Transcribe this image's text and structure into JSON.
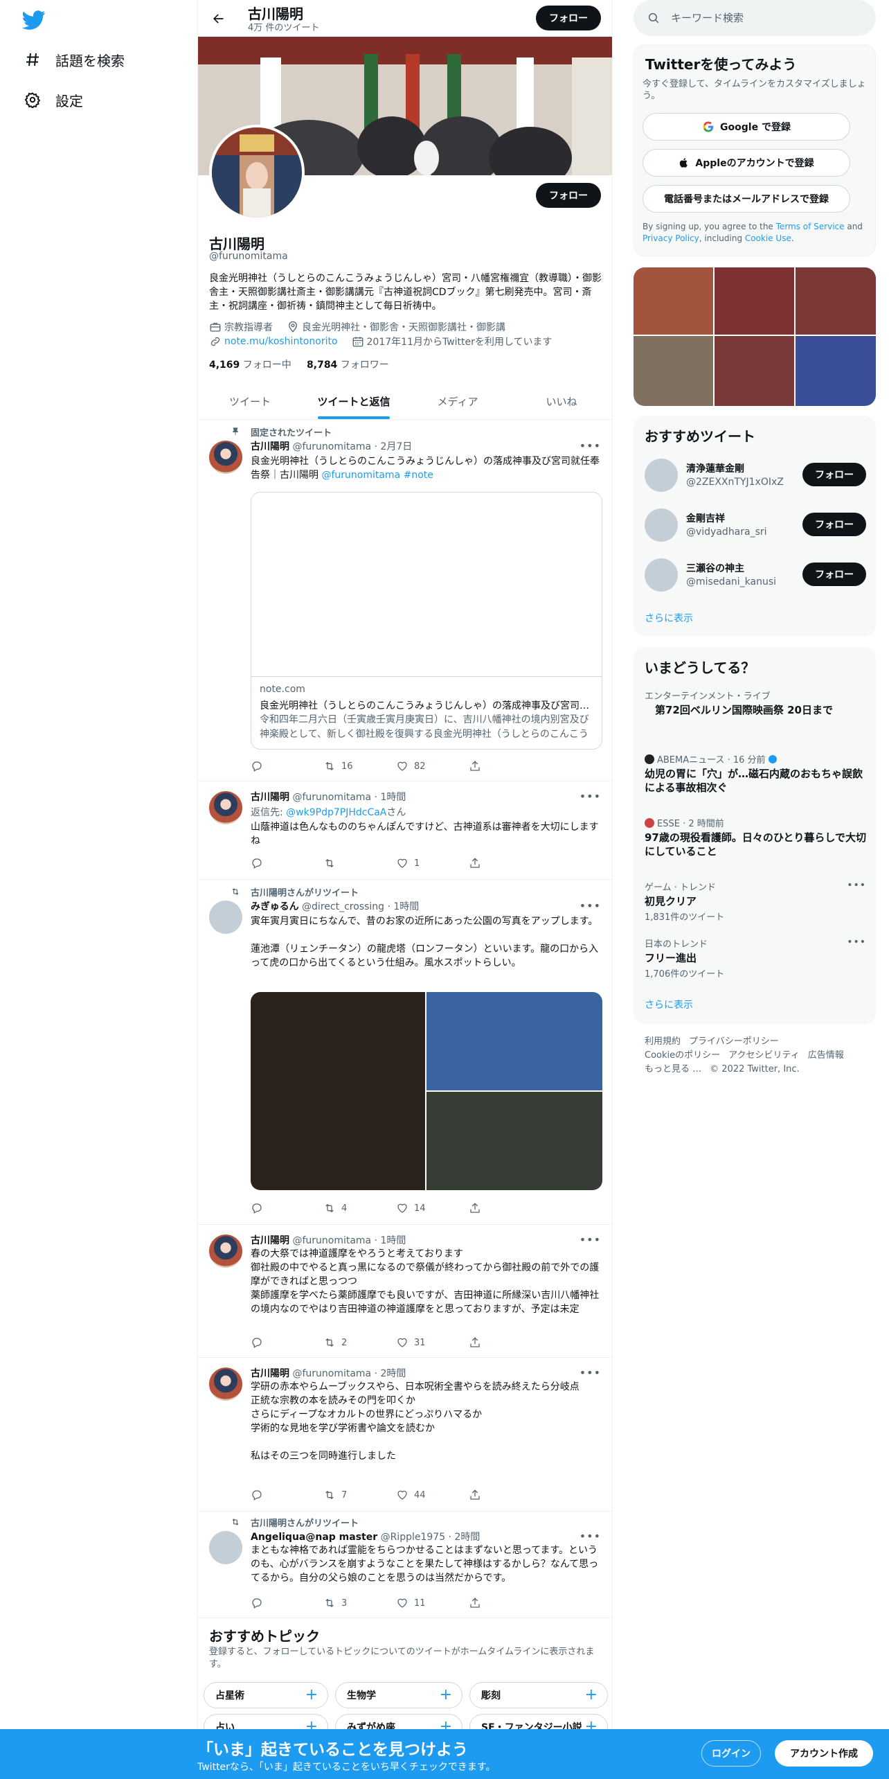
{
  "nav": {
    "explore": "話題を検索",
    "settings": "設定"
  },
  "header": {
    "name": "古川陽明",
    "tweet_count": "4万 件のツイート",
    "follow": "フォロー"
  },
  "profile": {
    "name": "古川陽明",
    "handle": "@furunomitama",
    "follow": "フォロー",
    "bio": "良金光明神社（うしとらのこんこうみょうじんしゃ）宮司・八幡宮権禰宜（教導職）・御影舎主・天照御影講社斎主・御影講講元『古神道祝詞CDブック』第七刷発売中。宮司・斎主・祝詞講座・御祈祷・鎮問神主として毎日祈祷中。",
    "category": "宗教指導者",
    "location": "良金光明神社・御影舎・天照御影講社・御影講",
    "link": "note.mu/koshintonorito",
    "joined": "2017年11月からTwitterを利用しています",
    "following_count": "4,169",
    "following_label": "フォロー中",
    "followers_count": "8,784",
    "followers_label": "フォロワー"
  },
  "tabs": [
    "ツイート",
    "ツイートと返信",
    "メディア",
    "いいね"
  ],
  "tweets": [
    {
      "context": "固定されたツイート",
      "name": "古川陽明",
      "meta": "@furunomitama · 2月7日",
      "text_a": "良金光明神社（うしとらのこんこうみょうじんしゃ）の落成神事及び宮司就任奉告祭｜古川陽明 ",
      "text_mention": "@furunomitama",
      "text_tag": " #note",
      "card": {
        "domain": "note.com",
        "title": "良金光明神社（うしとらのこんこうみょうじんしゃ）の落成神事及び宮司就任奉告祭｜古川陽明",
        "desc": "令和四年二月六日（壬寅歳壬寅月庚寅日）に、吉川八幡神社の境内別宮及び神楽殿として、新しく御社殿を復興する良金光明神社（うしとらのこんこうみょうじんしゃ）の落成神事及び宮司就任奉告祭を斎行しました。"
      },
      "retweets": "16",
      "likes": "82"
    },
    {
      "name": "古川陽明",
      "meta": "@furunomitama · 1時間",
      "reply_prefix": "返信先: ",
      "reply_to": "@wk9Pdp7PJHdcCaA",
      "reply_suffix": "さん",
      "text": "山蔭神道は色んなもののちゃんぽんですけど、古神道系は審神者を大切にしますね",
      "retweets": "",
      "likes": "1"
    },
    {
      "context": "古川陽明さんがリツイート",
      "name": "みぎゅるん",
      "meta": "@direct_crossing · 1時間",
      "text": "寅年寅月寅日にちなんで、昔のお家の近所にあった公園の写真をアップします。\n\n蓮池潭（リェンチータン）の龍虎塔（ロンフータン）といいます。龍の口から入って虎の口から出てくるという仕組み。風水スポットらしい。",
      "retweets": "4",
      "likes": "14"
    },
    {
      "name": "古川陽明",
      "meta": "@furunomitama · 1時間",
      "text": "春の大祭では神道護摩をやろうと考えております\n御社殿の中でやると真っ黒になるので祭儀が終わってから御社殿の前で外での護摩ができればと思っつつ\n薬師護摩を学べたら薬師護摩でも良いですが、吉田神道に所縁深い吉川八幡神社の境内なのでやはり吉田神道の神道護摩をと思っておりますが、予定は未定",
      "retweets": "2",
      "likes": "31"
    },
    {
      "name": "古川陽明",
      "meta": "@furunomitama · 2時間",
      "text": "学研の赤本やらムーブックスやら、日本呪術全書やらを読み終えたら分岐点\n正統な宗教の本を読みその門を叩くか\nさらにディープなオカルトの世界にどっぷりハマるか\n学術的な見地を学び学術書や論文を読むか\n\n私はその三つを同時進行しました",
      "retweets": "7",
      "likes": "44"
    },
    {
      "context": "古川陽明さんがリツイート",
      "name": "Angeliqua@nap master",
      "meta": "@Ripple1975 · 2時間",
      "text": "まともな神格であれば霊能をちらつかせることはまずないと思ってます。というのも、心がバランスを崩すようなことを果たして神様はするかしら？なんて思ってるから。自分の父ら娘のことを思うのは当然だからです。",
      "retweets": "3",
      "likes": "11"
    }
  ],
  "topics": {
    "title": "おすすめトピック",
    "subtitle": "登録すると、フォローしているトピックについてのツイートがホームタイムラインに表示されます。",
    "chips": [
      "占星術",
      "生物学",
      "彫刻",
      "占い",
      "みずがめ座",
      "SF・ファンタジー小説"
    ]
  },
  "search": {
    "placeholder": "キーワード検索"
  },
  "signup": {
    "title": "Twitterを使ってみよう",
    "subtitle": "今すぐ登録して、タイムラインをカスタマイズしましょう。",
    "google": "Google で登録",
    "apple": "Appleのアカウントで登録",
    "phone": "電話番号またはメールアドレスで登録",
    "terms_a": "By signing up, you agree to the ",
    "terms_tos": "Terms of Service",
    "terms_b": " and ",
    "terms_privacy": "Privacy Policy",
    "terms_c": ", including ",
    "terms_cookie": "Cookie Use",
    "terms_d": "."
  },
  "recommend": {
    "title": "おすすめツイート",
    "items": [
      {
        "name": "清浄蓮華金剛",
        "handle": "@2ZEXXnTYJ1xOIxZ",
        "follow": "フォロー"
      },
      {
        "name": "金剛吉祥",
        "handle": "@vidyadhara_sri",
        "follow": "フォロー"
      },
      {
        "name": "三瀬谷の神主",
        "handle": "@misedani_kanusi",
        "follow": "フォロー"
      }
    ],
    "more": "さらに表示"
  },
  "trends": {
    "title": "いまどうしてる？",
    "items": [
      {
        "context": "エンターテインメント・ライブ",
        "title": "　第72回ベルリン国際映画祭 20日まで",
        "count": ""
      },
      {
        "context": "ABEMAニュース · 16 分前",
        "title": "幼児の胃に「穴」が…磁石内蔵のおもちゃ誤飲による事故相次ぐ",
        "count": ""
      },
      {
        "context": "ESSE · 2 時間前",
        "title": "97歳の現役看護師。日々のひとり暮らしで大切にしていること",
        "count": ""
      },
      {
        "context": "ゲーム · トレンド",
        "title": "初見クリア",
        "count": "1,831件のツイート"
      },
      {
        "context": "日本のトレンド",
        "title": "フリー進出",
        "count": "1,706件のツイート"
      }
    ],
    "more": "さらに表示"
  },
  "footer": {
    "terms": "利用規約",
    "privacy": "プライバシーポリシー",
    "cookie": "Cookieのポリシー",
    "accessibility": "アクセシビリティ",
    "ads": "広告情報",
    "more": "もっと見る …",
    "copyright": "© 2022 Twitter, Inc."
  },
  "bottom": {
    "title": "「いま」起きていることを見つけよう",
    "subtitle": "Twitterなら、「いま」起きていることをいち早くチェックできます。",
    "login": "ログイン",
    "signup": "アカウント作成"
  },
  "colors": {
    "accent": "#1d9bf0",
    "text": "#0f1419",
    "secondary": "#536471",
    "border": "#eff3f4"
  },
  "icons": [
    "twitter-logo-icon",
    "hashtag-icon",
    "gear-icon",
    "back-arrow-icon",
    "search-icon",
    "briefcase-icon",
    "location-icon",
    "link-icon",
    "calendar-icon",
    "pin-icon",
    "retweet-icon",
    "reply-icon",
    "like-icon",
    "share-icon",
    "more-icon",
    "google-icon",
    "apple-icon",
    "verified-icon",
    "plus-icon"
  ]
}
